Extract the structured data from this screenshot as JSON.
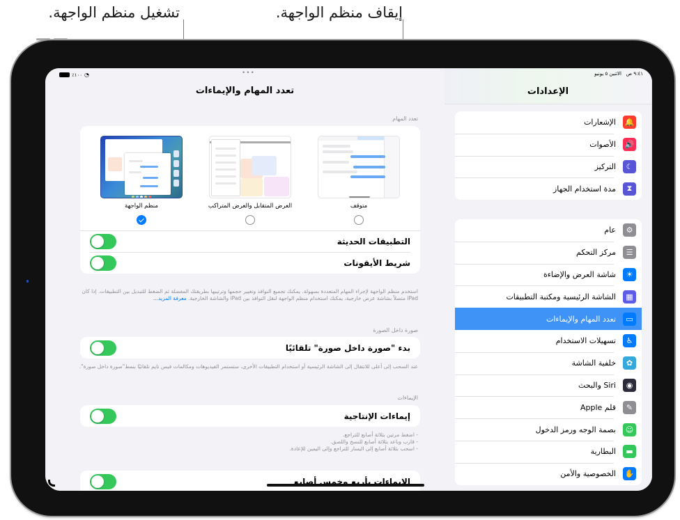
{
  "callouts": {
    "turn_off": "إيقاف منظم الواجهة.",
    "turn_on": "تشغيل منظم الواجهة."
  },
  "status_bar": {
    "time": "٩:٤١ ص",
    "date": "الاثنين ٥ يونيو",
    "battery": "٪١٠٠"
  },
  "detail": {
    "title": "تعدد المهام والإيماءات",
    "multitasking": {
      "section_label": "تعدد المهام",
      "options": [
        {
          "label": "متوقف",
          "selected": false,
          "thumbnail": "off-thumbnail"
        },
        {
          "label": "العرض المتقابل والعرض المتراكب",
          "selected": false,
          "thumbnail": "split-view-thumbnail"
        },
        {
          "label": "منظم الواجهة",
          "selected": true,
          "thumbnail": "stage-manager-thumbnail"
        }
      ],
      "toggles": [
        {
          "label": "التطبيقات الحديثة",
          "on": true
        },
        {
          "label": "شريط الأيقونات",
          "on": true
        }
      ],
      "footnote": "استخدم منظم الواجهة لإجراء المهام المتعددة بسهولة. يمكنك تجميع النوافذ وتغيير حجمها وترتيبها بطريقتك المفضلة ثم الضغط للتبديل بين التطبيقات. إذا كان iPad متصلاً بشاشة عرض خارجية، يمكنك استخدام منظم الواجهة لنقل النوافذ بين iPad والشاشة الخارجية.",
      "learn_more": "معرفة المزيد..."
    },
    "pip": {
      "section_label": "صورة داخل الصورة",
      "toggle_label": "بدء \"صورة داخل صورة\" تلقائيًا",
      "on": true,
      "footnote": "عند السحب إلى أعلى للانتقال إلى الشاشة الرئيسية أو استخدام التطبيقات الأخرى، ستستمر الفيديوهات ومكالمات فيس تايم تلقائيًا بنمط\"صورة داخل صورة\"."
    },
    "gestures": {
      "section_label": "الإيماءات",
      "toggle_label": "إيماءات الإنتاجية",
      "on": true,
      "footnote_lines": [
        "- اضغط مرتين بثلاثة أصابع للتراجع.",
        "- قارب وباعد بثلاثة أصابع للنسخ واللصق.",
        "- اسحب بثلاثة أصابع إلى اليسار للتراجع وإلى اليمين للإعادة."
      ],
      "four_five_label": "الإيماءات بأربع وخمس أصابع",
      "four_five_on": true
    }
  },
  "sidebar": {
    "title": "الإعدادات",
    "groups": [
      [
        {
          "label": "الإشعارات",
          "icon": "bell-icon",
          "color": "#ff3b30",
          "glyph": "🔔"
        },
        {
          "label": "الأصوات",
          "icon": "speaker-icon",
          "color": "#ff2d55",
          "glyph": "🔊"
        },
        {
          "label": "التركيز",
          "icon": "moon-icon",
          "color": "#5856d6",
          "glyph": "☾"
        },
        {
          "label": "مدة استخدام الجهاز",
          "icon": "hourglass-icon",
          "color": "#5856d6",
          "glyph": "⧗"
        }
      ],
      [
        {
          "label": "عام",
          "icon": "gear-icon",
          "color": "#8e8e93",
          "glyph": "⚙"
        },
        {
          "label": "مركز التحكم",
          "icon": "switches-icon",
          "color": "#8e8e93",
          "glyph": "☰"
        },
        {
          "label": "شاشة العرض والإضاءة",
          "icon": "sun-icon",
          "color": "#007aff",
          "glyph": "☀"
        },
        {
          "label": "الشاشة الرئيسية ومكتبة التطبيقات",
          "icon": "app-grid-icon",
          "color": "#5e5ce6",
          "glyph": "▦"
        },
        {
          "label": "تعدد المهام والإيماءات",
          "icon": "multitasking-icon",
          "color": "#007aff",
          "glyph": "▭",
          "selected": true
        },
        {
          "label": "تسهيلات الاستخدام",
          "icon": "accessibility-icon",
          "color": "#007aff",
          "glyph": "♿"
        },
        {
          "label": "خلفية الشاشة",
          "icon": "flower-icon",
          "color": "#34aadc",
          "glyph": "✿"
        },
        {
          "label": "Siri والبحث",
          "icon": "siri-icon",
          "color": "#2b2b3a",
          "glyph": "◉"
        },
        {
          "label": "قلم Apple",
          "icon": "pencil-icon",
          "color": "#8e8e93",
          "glyph": "✎"
        },
        {
          "label": "بصمة الوجه ورمز الدخول",
          "icon": "face-id-icon",
          "color": "#34c759",
          "glyph": "☺"
        },
        {
          "label": "البطارية",
          "icon": "battery-icon",
          "color": "#34c759",
          "glyph": "▬"
        },
        {
          "label": "الخصوصية والأمن",
          "icon": "hand-icon",
          "color": "#007aff",
          "glyph": "✋"
        }
      ]
    ]
  }
}
